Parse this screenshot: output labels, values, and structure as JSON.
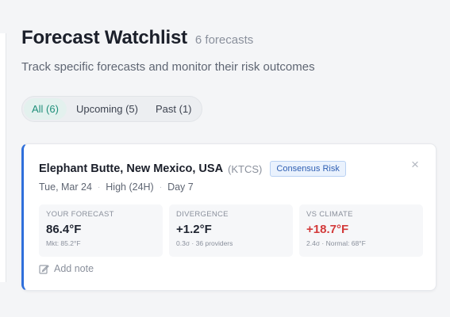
{
  "header": {
    "title": "Forecast Watchlist",
    "count_label": "6 forecasts",
    "subtitle": "Track specific forecasts and monitor their risk outcomes"
  },
  "tabs": [
    {
      "label": "All (6)",
      "active": true
    },
    {
      "label": "Upcoming (5)",
      "active": false
    },
    {
      "label": "Past (1)",
      "active": false
    }
  ],
  "card": {
    "location": "Elephant Butte, New Mexico, USA",
    "station": "(KTCS)",
    "badge": "Consensus Risk",
    "meta": {
      "date": "Tue, Mar 24",
      "variable": "High (24H)",
      "day": "Day 7"
    },
    "metrics": [
      {
        "label": "YOUR FORECAST",
        "value": "86.4°F",
        "sub": "Mkt: 85.2°F"
      },
      {
        "label": "DIVERGENCE",
        "value": "+1.2°F",
        "sub": "0.3σ · 36 providers"
      },
      {
        "label": "VS CLIMATE",
        "value": "+18.7°F",
        "sub": "2.4σ · Normal: 68°F"
      }
    ],
    "add_note": "Add note"
  },
  "colors": {
    "accent_teal": "#1f8f7a",
    "card_border_blue": "#2f6fdb",
    "badge_blue": "#2f5fb3",
    "warning_red": "#d33a3a"
  },
  "icons": {
    "close": "close-icon",
    "note": "pencil-icon"
  }
}
